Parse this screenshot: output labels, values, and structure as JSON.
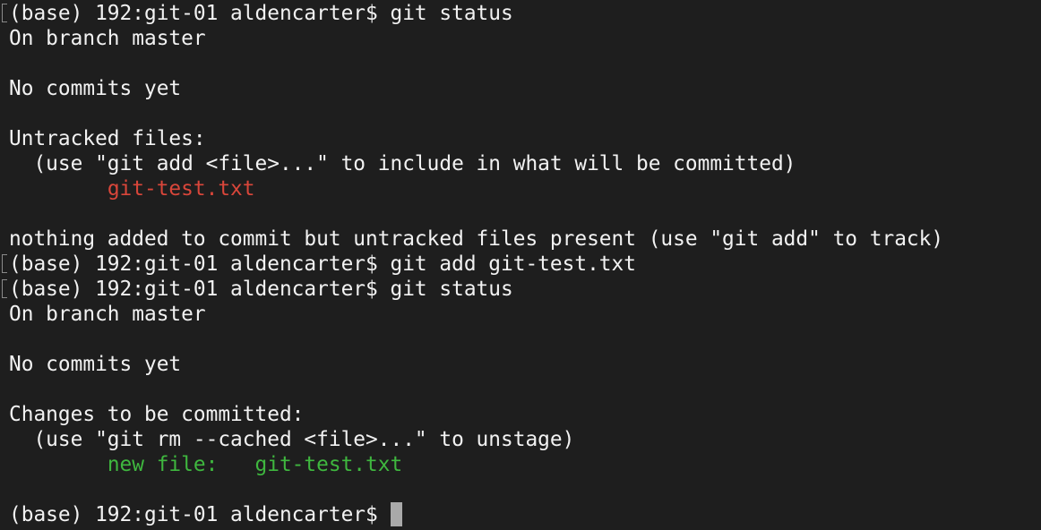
{
  "lines": [
    {
      "kind": "command",
      "marked": true,
      "prompt": "(base) 192:git-01 aldencarter$ ",
      "command": "git status"
    },
    {
      "kind": "text",
      "text": "On branch master"
    },
    {
      "kind": "text",
      "text": ""
    },
    {
      "kind": "text",
      "text": "No commits yet"
    },
    {
      "kind": "text",
      "text": ""
    },
    {
      "kind": "text",
      "text": "Untracked files:"
    },
    {
      "kind": "text",
      "text": "  (use \"git add <file>...\" to include in what will be committed)"
    },
    {
      "kind": "file",
      "color": "red",
      "indent": "        ",
      "text": "git-test.txt"
    },
    {
      "kind": "text",
      "text": ""
    },
    {
      "kind": "text",
      "text": "nothing added to commit but untracked files present (use \"git add\" to track)"
    },
    {
      "kind": "command",
      "marked": true,
      "prompt": "(base) 192:git-01 aldencarter$ ",
      "command": "git add git-test.txt"
    },
    {
      "kind": "command",
      "marked": true,
      "prompt": "(base) 192:git-01 aldencarter$ ",
      "command": "git status"
    },
    {
      "kind": "text",
      "text": "On branch master"
    },
    {
      "kind": "text",
      "text": ""
    },
    {
      "kind": "text",
      "text": "No commits yet"
    },
    {
      "kind": "text",
      "text": ""
    },
    {
      "kind": "text",
      "text": "Changes to be committed:"
    },
    {
      "kind": "text",
      "text": "  (use \"git rm --cached <file>...\" to unstage)"
    },
    {
      "kind": "file",
      "color": "green",
      "indent": "        ",
      "text": "new file:   git-test.txt"
    },
    {
      "kind": "text",
      "text": ""
    },
    {
      "kind": "prompt",
      "marked": false,
      "prompt": "(base) 192:git-01 aldencarter$ ",
      "command": ""
    }
  ],
  "colors": {
    "background": "#1e1e1e",
    "text": "#f2f2f2",
    "untracked": "#d9463a",
    "staged": "#3fb73f",
    "cursor": "#a9a9a9"
  }
}
